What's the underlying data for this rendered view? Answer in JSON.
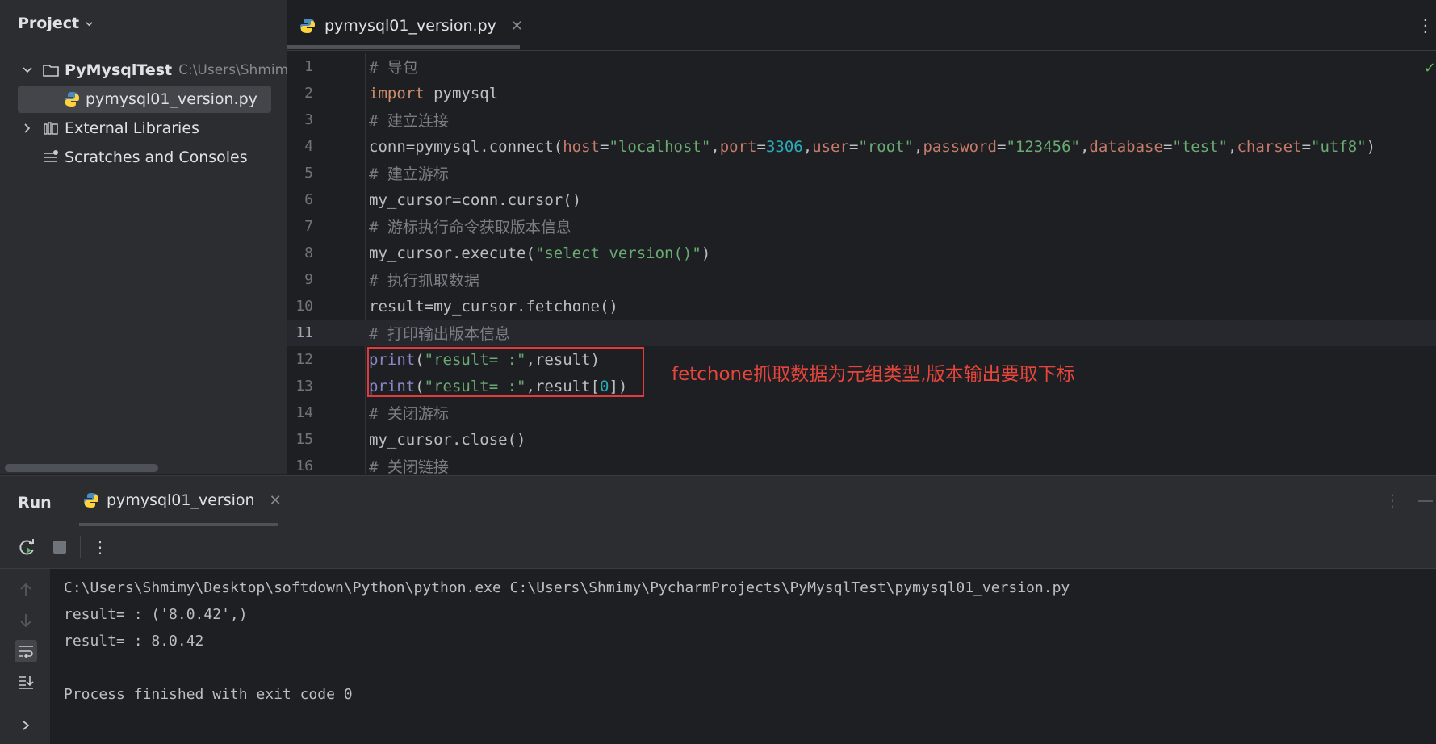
{
  "project": {
    "title": "Project",
    "root_name": "PyMysqlTest",
    "root_path": "C:\\Users\\Shmimy\\",
    "file_name": "pymysql01_version.py",
    "external_libraries": "External Libraries",
    "scratches": "Scratches and Consoles"
  },
  "editor": {
    "tab_label": "pymysql01_version.py",
    "current_line": 11,
    "lines": [
      {
        "n": "1",
        "code": "# 导包"
      },
      {
        "n": "2",
        "code": "import pymysql"
      },
      {
        "n": "3",
        "code": "# 建立连接"
      },
      {
        "n": "4",
        "code": "conn=pymysql.connect(host=\"localhost\",port=3306,user=\"root\",password=\"123456\",database=\"test\",charset=\"utf8\")"
      },
      {
        "n": "5",
        "code": "# 建立游标"
      },
      {
        "n": "6",
        "code": "my_cursor=conn.cursor()"
      },
      {
        "n": "7",
        "code": "# 游标执行命令获取版本信息"
      },
      {
        "n": "8",
        "code": "my_cursor.execute(\"select version()\")"
      },
      {
        "n": "9",
        "code": "# 执行抓取数据"
      },
      {
        "n": "10",
        "code": "result=my_cursor.fetchone()"
      },
      {
        "n": "11",
        "code": "# 打印输出版本信息"
      },
      {
        "n": "12",
        "code": "print(\"result= :\",result)"
      },
      {
        "n": "13",
        "code": "print(\"result= :\",result[0])"
      },
      {
        "n": "14",
        "code": "# 关闭游标"
      },
      {
        "n": "15",
        "code": "my_cursor.close()"
      },
      {
        "n": "16",
        "code": "# 关闭链接"
      }
    ],
    "annotation": "fetchone抓取数据为元组类型,版本输出要取下标"
  },
  "run": {
    "title": "Run",
    "tab_label": "pymysql01_version",
    "console": [
      "C:\\Users\\Shmimy\\Desktop\\softdown\\Python\\python.exe C:\\Users\\Shmimy\\PycharmProjects\\PyMysqlTest\\pymysql01_version.py",
      "result= : ('8.0.42',)",
      "result= : 8.0.42",
      "",
      "Process finished with exit code 0"
    ]
  },
  "colors": {
    "background": "#1e1f22",
    "panel": "#2b2d30",
    "annotation_red": "#e03c3c",
    "keyword": "#cf8e6d",
    "string": "#6aab73",
    "number": "#2aacb8"
  }
}
